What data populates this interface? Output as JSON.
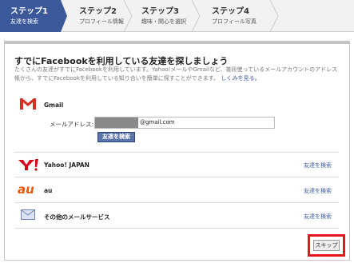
{
  "steps": [
    {
      "num": "ステップ1",
      "sub": "友達を検索"
    },
    {
      "num": "ステップ2",
      "sub": "プロフィール情報"
    },
    {
      "num": "ステップ3",
      "sub": "趣味・関心を選択"
    },
    {
      "num": "ステップ4",
      "sub": "プロフィール写真"
    }
  ],
  "main": {
    "title": "すでにFacebookを利用している友達を探しましょう",
    "description": "たくさんの友達がすでにFacebookを利用しています。Yahoo!メールやGmailなど、普段使っているメールアカウントのアドレス帳から、すでにFacebookを利用している知り合いを簡単に探すことができます。",
    "learn_more": "しくみを見る。"
  },
  "gmail": {
    "label": "Gmail",
    "email_label": "メールアドレス:",
    "email_domain": "@gmail.com",
    "search_button": "友達を検索"
  },
  "services": [
    {
      "name": "Yahoo! JAPAN",
      "link": "友達を検索"
    },
    {
      "name": "au",
      "link": "友達を検索"
    },
    {
      "name": "その他のメールサービス",
      "link": "友達を検索"
    }
  ],
  "skip_button": "スキップ",
  "colors": {
    "accent": "#3b5998",
    "highlight": "#e8141b"
  }
}
